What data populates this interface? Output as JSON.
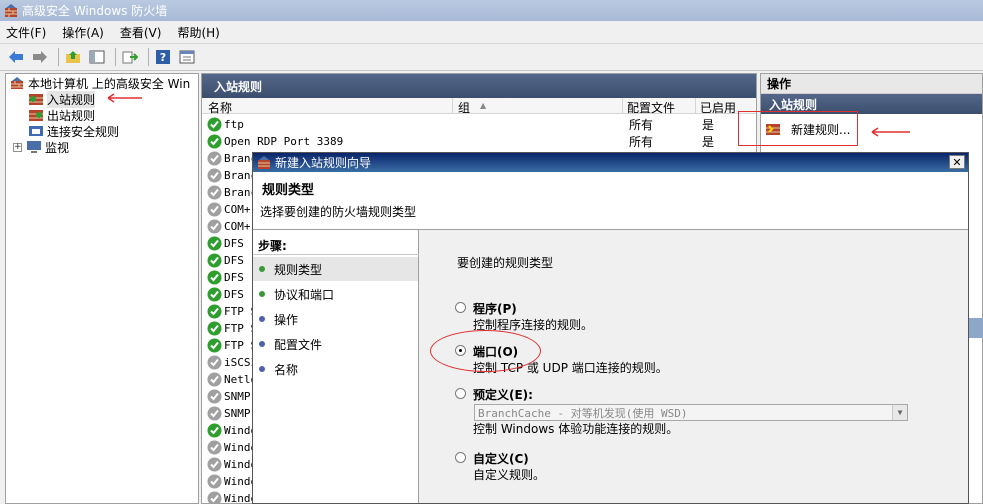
{
  "window": {
    "title": "高级安全 Windows 防火墙"
  },
  "menu": [
    "文件(F)",
    "操作(A)",
    "查看(V)",
    "帮助(H)"
  ],
  "toolbar": {
    "buttons": [
      "back-icon",
      "forward-icon",
      "up-folder-icon",
      "show-hide-tree-icon",
      "export-icon",
      "help-icon",
      "properties-icon"
    ]
  },
  "tree": {
    "root": "本地计算机 上的高级安全 Win",
    "items": [
      "入站规则",
      "出站规则",
      "连接安全规则",
      "监视"
    ],
    "expander": "+"
  },
  "center": {
    "title": "入站规则",
    "columns": [
      "名称",
      "组",
      "配置文件",
      "已启用"
    ],
    "sort_marker": "▲",
    "rows": [
      {
        "name": "ftp",
        "profile": "所有",
        "enabled": "是",
        "status": "enabled"
      },
      {
        "name": "Open RDP Port 3389",
        "profile": "所有",
        "enabled": "是",
        "status": "enabled"
      },
      {
        "name": "Branc",
        "profile": "",
        "enabled": "",
        "status": "disabled"
      },
      {
        "name": "Branc",
        "profile": "",
        "enabled": "",
        "status": "disabled"
      },
      {
        "name": "Branc",
        "profile": "",
        "enabled": "",
        "status": "disabled"
      },
      {
        "name": "COM+",
        "profile": "",
        "enabled": "",
        "status": "disabled"
      },
      {
        "name": "COM+",
        "profile": "",
        "enabled": "",
        "status": "disabled"
      },
      {
        "name": "DFS '",
        "profile": "",
        "enabled": "",
        "status": "enabled"
      },
      {
        "name": "DFS '",
        "profile": "",
        "enabled": "",
        "status": "enabled"
      },
      {
        "name": "DFS '",
        "profile": "",
        "enabled": "",
        "status": "enabled"
      },
      {
        "name": "DFS '",
        "profile": "",
        "enabled": "",
        "status": "enabled"
      },
      {
        "name": "FTP S",
        "profile": "",
        "enabled": "",
        "status": "enabled"
      },
      {
        "name": "FTP S",
        "profile": "",
        "enabled": "",
        "status": "enabled"
      },
      {
        "name": "FTP S",
        "profile": "",
        "enabled": "",
        "status": "enabled"
      },
      {
        "name": "iSCSI",
        "profile": "",
        "enabled": "",
        "status": "disabled"
      },
      {
        "name": "Netlo",
        "profile": "",
        "enabled": "",
        "status": "disabled"
      },
      {
        "name": "SNMP",
        "profile": "",
        "enabled": "",
        "status": "disabled"
      },
      {
        "name": "SNMP",
        "profile": "",
        "enabled": "",
        "status": "disabled"
      },
      {
        "name": "Windo",
        "profile": "",
        "enabled": "",
        "status": "enabled"
      },
      {
        "name": "Windo",
        "profile": "",
        "enabled": "",
        "status": "disabled"
      },
      {
        "name": "Windo",
        "profile": "",
        "enabled": "",
        "status": "disabled"
      },
      {
        "name": "Windo",
        "profile": "",
        "enabled": "",
        "status": "disabled"
      },
      {
        "name": "Windo",
        "profile": "",
        "enabled": "",
        "status": "disabled"
      }
    ]
  },
  "actions": {
    "title": "操作",
    "section": "入站规则",
    "items": [
      "新建规则..."
    ]
  },
  "dialog": {
    "title": "新建入站规则向导",
    "close": "✕",
    "heading": "规则类型",
    "subheading": "选择要创建的防火墙规则类型",
    "steps_title": "步骤:",
    "steps": [
      "规则类型",
      "协议和端口",
      "操作",
      "配置文件",
      "名称"
    ],
    "question": "要创建的规则类型",
    "options": [
      {
        "label": "程序(P)",
        "desc": "控制程序连接的规则。",
        "checked": false
      },
      {
        "label": "端口(O)",
        "desc": "控制 TCP 或 UDP 端口连接的规则。",
        "checked": true
      },
      {
        "label": "预定义(E):",
        "desc": "控制 Windows 体验功能连接的规则。",
        "checked": false
      },
      {
        "label": "自定义(C)",
        "desc": "自定义规则。",
        "checked": false
      }
    ],
    "predefined_value": "BranchCache - 对等机发现(使用 WSD)"
  },
  "colors": {
    "accent_header": "#3b4e6d",
    "dialog_title": "#0a246a",
    "annotation_red": "#e03030",
    "enabled_green": "#2e9e2e",
    "disabled_gray": "#a0a0a0"
  }
}
